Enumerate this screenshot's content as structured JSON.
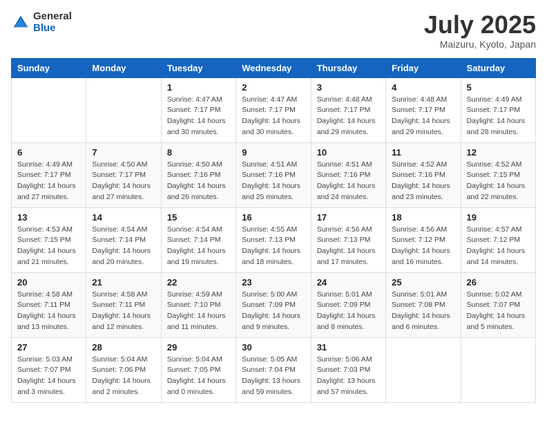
{
  "header": {
    "logo_general": "General",
    "logo_blue": "Blue",
    "month_title": "July 2025",
    "location": "Maizuru, Kyoto, Japan"
  },
  "weekdays": [
    "Sunday",
    "Monday",
    "Tuesday",
    "Wednesday",
    "Thursday",
    "Friday",
    "Saturday"
  ],
  "weeks": [
    [
      {
        "day": "",
        "info": ""
      },
      {
        "day": "",
        "info": ""
      },
      {
        "day": "1",
        "info": "Sunrise: 4:47 AM\nSunset: 7:17 PM\nDaylight: 14 hours and 30 minutes."
      },
      {
        "day": "2",
        "info": "Sunrise: 4:47 AM\nSunset: 7:17 PM\nDaylight: 14 hours and 30 minutes."
      },
      {
        "day": "3",
        "info": "Sunrise: 4:48 AM\nSunset: 7:17 PM\nDaylight: 14 hours and 29 minutes."
      },
      {
        "day": "4",
        "info": "Sunrise: 4:48 AM\nSunset: 7:17 PM\nDaylight: 14 hours and 29 minutes."
      },
      {
        "day": "5",
        "info": "Sunrise: 4:49 AM\nSunset: 7:17 PM\nDaylight: 14 hours and 28 minutes."
      }
    ],
    [
      {
        "day": "6",
        "info": "Sunrise: 4:49 AM\nSunset: 7:17 PM\nDaylight: 14 hours and 27 minutes."
      },
      {
        "day": "7",
        "info": "Sunrise: 4:50 AM\nSunset: 7:17 PM\nDaylight: 14 hours and 27 minutes."
      },
      {
        "day": "8",
        "info": "Sunrise: 4:50 AM\nSunset: 7:16 PM\nDaylight: 14 hours and 26 minutes."
      },
      {
        "day": "9",
        "info": "Sunrise: 4:51 AM\nSunset: 7:16 PM\nDaylight: 14 hours and 25 minutes."
      },
      {
        "day": "10",
        "info": "Sunrise: 4:51 AM\nSunset: 7:16 PM\nDaylight: 14 hours and 24 minutes."
      },
      {
        "day": "11",
        "info": "Sunrise: 4:52 AM\nSunset: 7:16 PM\nDaylight: 14 hours and 23 minutes."
      },
      {
        "day": "12",
        "info": "Sunrise: 4:52 AM\nSunset: 7:15 PM\nDaylight: 14 hours and 22 minutes."
      }
    ],
    [
      {
        "day": "13",
        "info": "Sunrise: 4:53 AM\nSunset: 7:15 PM\nDaylight: 14 hours and 21 minutes."
      },
      {
        "day": "14",
        "info": "Sunrise: 4:54 AM\nSunset: 7:14 PM\nDaylight: 14 hours and 20 minutes."
      },
      {
        "day": "15",
        "info": "Sunrise: 4:54 AM\nSunset: 7:14 PM\nDaylight: 14 hours and 19 minutes."
      },
      {
        "day": "16",
        "info": "Sunrise: 4:55 AM\nSunset: 7:13 PM\nDaylight: 14 hours and 18 minutes."
      },
      {
        "day": "17",
        "info": "Sunrise: 4:56 AM\nSunset: 7:13 PM\nDaylight: 14 hours and 17 minutes."
      },
      {
        "day": "18",
        "info": "Sunrise: 4:56 AM\nSunset: 7:12 PM\nDaylight: 14 hours and 16 minutes."
      },
      {
        "day": "19",
        "info": "Sunrise: 4:57 AM\nSunset: 7:12 PM\nDaylight: 14 hours and 14 minutes."
      }
    ],
    [
      {
        "day": "20",
        "info": "Sunrise: 4:58 AM\nSunset: 7:11 PM\nDaylight: 14 hours and 13 minutes."
      },
      {
        "day": "21",
        "info": "Sunrise: 4:58 AM\nSunset: 7:11 PM\nDaylight: 14 hours and 12 minutes."
      },
      {
        "day": "22",
        "info": "Sunrise: 4:59 AM\nSunset: 7:10 PM\nDaylight: 14 hours and 11 minutes."
      },
      {
        "day": "23",
        "info": "Sunrise: 5:00 AM\nSunset: 7:09 PM\nDaylight: 14 hours and 9 minutes."
      },
      {
        "day": "24",
        "info": "Sunrise: 5:01 AM\nSunset: 7:09 PM\nDaylight: 14 hours and 8 minutes."
      },
      {
        "day": "25",
        "info": "Sunrise: 5:01 AM\nSunset: 7:08 PM\nDaylight: 14 hours and 6 minutes."
      },
      {
        "day": "26",
        "info": "Sunrise: 5:02 AM\nSunset: 7:07 PM\nDaylight: 14 hours and 5 minutes."
      }
    ],
    [
      {
        "day": "27",
        "info": "Sunrise: 5:03 AM\nSunset: 7:07 PM\nDaylight: 14 hours and 3 minutes."
      },
      {
        "day": "28",
        "info": "Sunrise: 5:04 AM\nSunset: 7:06 PM\nDaylight: 14 hours and 2 minutes."
      },
      {
        "day": "29",
        "info": "Sunrise: 5:04 AM\nSunset: 7:05 PM\nDaylight: 14 hours and 0 minutes."
      },
      {
        "day": "30",
        "info": "Sunrise: 5:05 AM\nSunset: 7:04 PM\nDaylight: 13 hours and 59 minutes."
      },
      {
        "day": "31",
        "info": "Sunrise: 5:06 AM\nSunset: 7:03 PM\nDaylight: 13 hours and 57 minutes."
      },
      {
        "day": "",
        "info": ""
      },
      {
        "day": "",
        "info": ""
      }
    ]
  ]
}
